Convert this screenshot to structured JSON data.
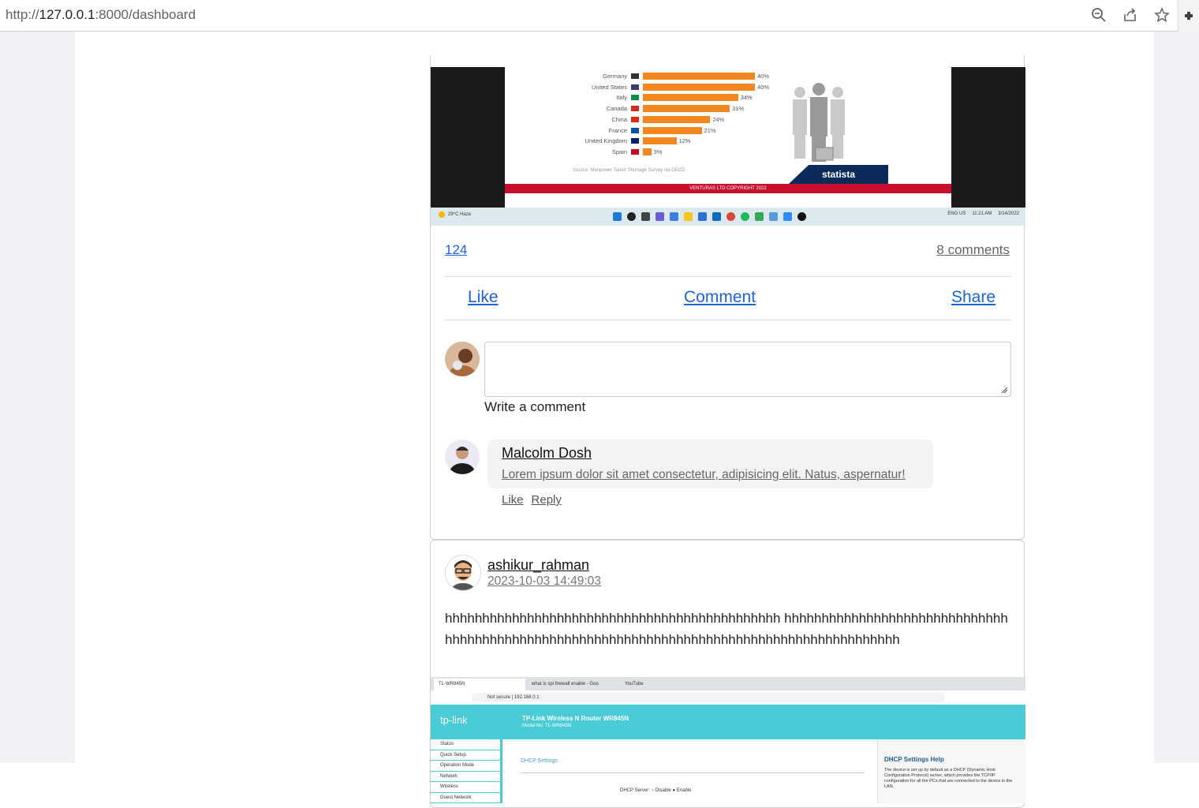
{
  "browser": {
    "url_scheme": "http://",
    "url_host": "127.0.0.1",
    "url_rest": ":8000/dashboard"
  },
  "post1": {
    "image": {
      "countries": [
        {
          "name": "Germany",
          "pct": 40,
          "label": "40%"
        },
        {
          "name": "United States",
          "pct": 40,
          "label": "40%"
        },
        {
          "name": "Italy",
          "pct": 34,
          "label": "34%"
        },
        {
          "name": "Canada",
          "pct": 31,
          "label": "31%"
        },
        {
          "name": "China",
          "pct": 24,
          "label": "24%"
        },
        {
          "name": "France",
          "pct": 21,
          "label": "21%"
        },
        {
          "name": "United Kingdom",
          "pct": 12,
          "label": "12%"
        },
        {
          "name": "Spain",
          "pct": 3,
          "label": "3%"
        }
      ],
      "bar_color": "#f2871f",
      "source": "Source: Manpower Talent Shortage Survey via OECD",
      "brand": "statista",
      "copyright": "VENTURAS LTD COPYRIGHT 2022",
      "taskbar_weather": "29°C Haze",
      "taskbar_lang": "ENG US",
      "taskbar_time": "11:21 AM",
      "taskbar_date": "3/14/2022"
    },
    "likes": "124",
    "comments_count": "8 comments",
    "actions": {
      "like": "Like",
      "comment": "Comment",
      "share": "Share"
    },
    "comment_label": "Write a comment",
    "comment": {
      "author": "Malcolm Dosh",
      "text": "Lorem ipsum dolor sit amet consectetur, adipisicing elit. Natus, aspernatur!",
      "like": "Like",
      "reply": "Reply"
    }
  },
  "post2": {
    "author": "ashikur_rahman",
    "date": "2023-10-03 14:49:03",
    "body": "hhhhhhhhhhhhhhhhhhhhhhhhhhhhhhhhhhhhhhhhhhhhh hhhhhhhhhhhhhhhhhhhhhhhhhhhhhhhhhhhhhhhhhhhhhhhhhhhhhhhhhhhhhhhhhhhhhhhhhhhhhhhhhhhhhhhhhhh",
    "image": {
      "tab1": "TL-WR845N",
      "tab2": "what is spi firewall enable - Goo",
      "tab3": "YouTube",
      "url": "Not secure | 192.168.0.1",
      "logo": "tp-link",
      "title": "TP-Link Wireless N Router WR845N",
      "model": "Model No. TL-WR845N",
      "menu": [
        "Status",
        "Quick Setup",
        "Operation Mode",
        "Network",
        "Wireless",
        "Guest Network"
      ],
      "section": "DHCP Settings",
      "server_label": "DHCP Server:",
      "server_disable": "Disable",
      "server_enable": "Enable",
      "help_title": "DHCP Settings Help",
      "help_text": "The device is set up by default as a DHCP (Dynamic Host Configuration Protocol) server, which provides the TCP/IP configuration for all the PCs that are connected to the device in the LAN."
    }
  }
}
